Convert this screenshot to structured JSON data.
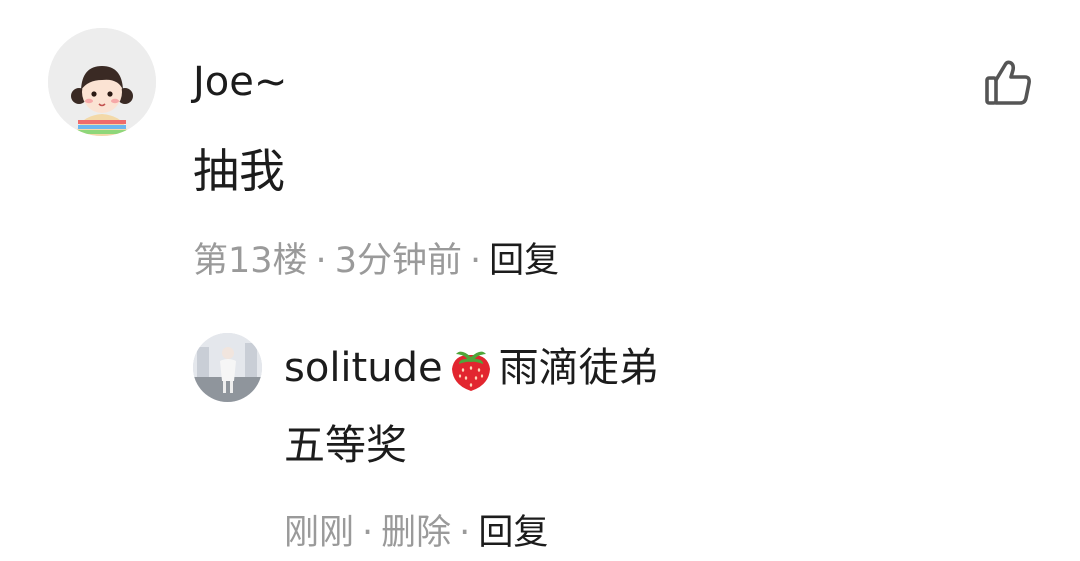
{
  "comment": {
    "avatar_icon": "cartoon-girl-avatar-icon",
    "username": "Joe~",
    "text": "抽我",
    "meta": {
      "floor": "第13楼",
      "separator": "·",
      "time": "3分钟前",
      "reply_label": "回复"
    },
    "like_icon": "thumbs-up-icon"
  },
  "reply": {
    "avatar_icon": "photo-avatar-icon",
    "username_prefix": "solitude",
    "username_emoji": "strawberry-icon",
    "username_suffix": "雨滴徒弟",
    "text": "五等奖",
    "meta": {
      "time": "刚刚",
      "separator": "·",
      "delete_label": "删除",
      "reply_label": "回复"
    }
  },
  "colors": {
    "primary_text": "#1c1c1c",
    "secondary_text": "#9a9a9a",
    "background": "#ffffff"
  }
}
